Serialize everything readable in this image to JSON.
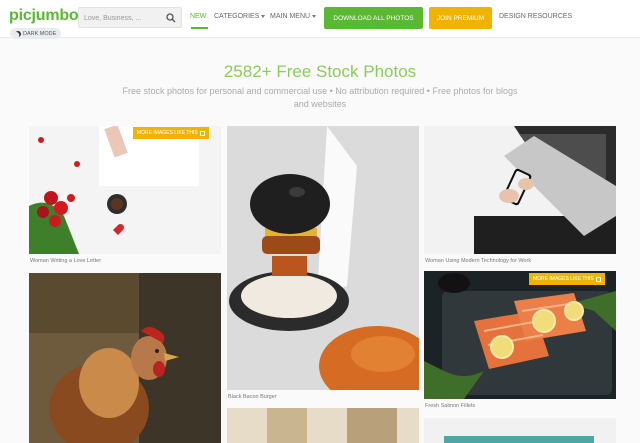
{
  "header": {
    "logo": "picjumbo",
    "dark_mode_label": "DARK MODE",
    "search_placeholder": "Love, Business, ...",
    "nav": {
      "new": "NEW",
      "categories": "CATEGORIES",
      "main_menu": "MAIN MENU",
      "download_all": "DOWNLOAD ALL PHOTOS",
      "join_premium": "JOIN PREMIUM",
      "design_resources": "DESIGN RESOURCES"
    }
  },
  "hero": {
    "title": "2582+ Free Stock Photos",
    "subtitle": "Free stock photos for personal and commercial use • No attribution required • Free photos for blogs and websites"
  },
  "photos": [
    {
      "caption": "Woman Writing a Love Letter",
      "badge": "MORE IMAGES LIKE THIS"
    },
    {
      "caption": "Black Bacon Burger"
    },
    {
      "caption": "Woman Using Modern Technology for Work"
    },
    {
      "caption": "Fresh Salmon Fillets",
      "badge": "MORE IMAGES LIKE THIS"
    },
    {
      "caption": ""
    }
  ],
  "colors": {
    "brand_green": "#5bb832",
    "premium_yellow": "#f0b400"
  }
}
